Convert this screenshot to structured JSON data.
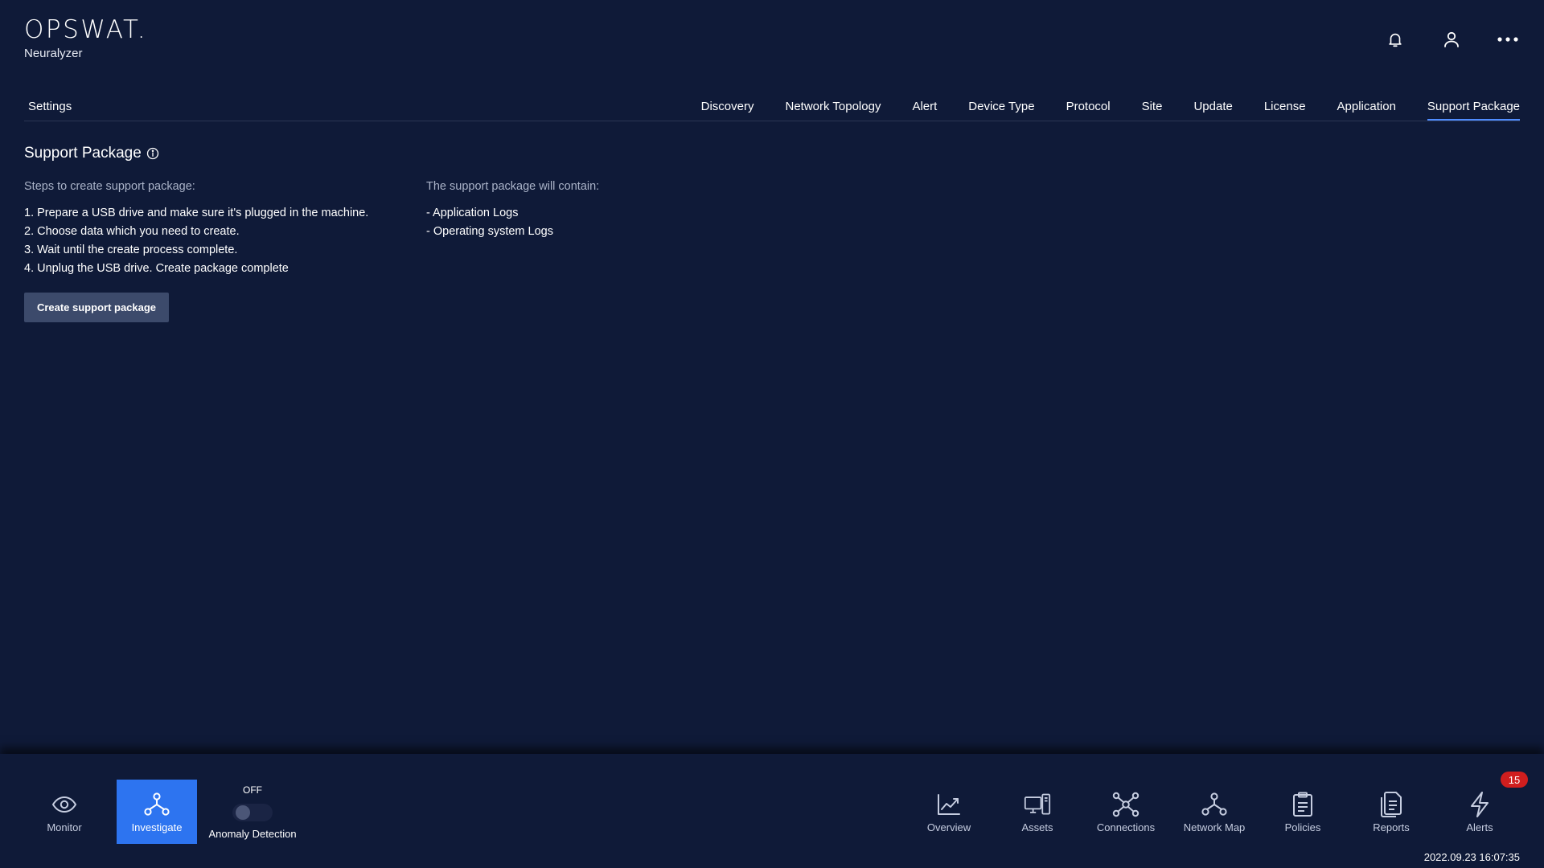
{
  "brand": {
    "logo": "OPSWAT.",
    "product": "Neuralyzer"
  },
  "header": {
    "icons": [
      "bell-icon",
      "user-icon",
      "more-icon"
    ]
  },
  "settings": {
    "title": "Settings",
    "tabs": [
      {
        "label": "Discovery",
        "active": false
      },
      {
        "label": "Network Topology",
        "active": false
      },
      {
        "label": "Alert",
        "active": false
      },
      {
        "label": "Device Type",
        "active": false
      },
      {
        "label": "Protocol",
        "active": false
      },
      {
        "label": "Site",
        "active": false
      },
      {
        "label": "Update",
        "active": false
      },
      {
        "label": "License",
        "active": false
      },
      {
        "label": "Application",
        "active": false
      },
      {
        "label": "Support Package",
        "active": true
      }
    ]
  },
  "page": {
    "title": "Support Package",
    "steps_heading": "Steps to create support package:",
    "steps": [
      "1. Prepare a USB drive and make sure it's plugged in the machine.",
      "2. Choose data which you need to create.",
      "3. Wait until the create process complete.",
      "4. Unplug the USB drive. Create package complete"
    ],
    "contents_heading": "The support package will contain:",
    "contents": [
      "- Application Logs",
      "- Operating system Logs"
    ],
    "create_button": "Create support package"
  },
  "bottom_nav": {
    "left": [
      {
        "label": "Monitor",
        "icon": "eye-icon",
        "active": false
      },
      {
        "label": "Investigate",
        "icon": "hierarchy-icon",
        "active": true
      }
    ],
    "anomaly": {
      "state": "OFF",
      "label": "Anomaly Detection",
      "on": false
    },
    "right": [
      {
        "label": "Overview",
        "icon": "chart-line-icon"
      },
      {
        "label": "Assets",
        "icon": "devices-icon"
      },
      {
        "label": "Connections",
        "icon": "network-icon"
      },
      {
        "label": "Network Map",
        "icon": "network-map-icon"
      },
      {
        "label": "Policies",
        "icon": "clipboard-icon"
      },
      {
        "label": "Reports",
        "icon": "reports-icon"
      },
      {
        "label": "Alerts",
        "icon": "bolt-icon"
      }
    ],
    "alerts_badge": "15",
    "timestamp": "2022.09.23 16:07:35"
  },
  "colors": {
    "background": "#0f1a38",
    "accent": "#2d74f0",
    "tab_underline": "#4f8cff",
    "badge": "#d01e1e",
    "button": "#3c4a6b"
  }
}
